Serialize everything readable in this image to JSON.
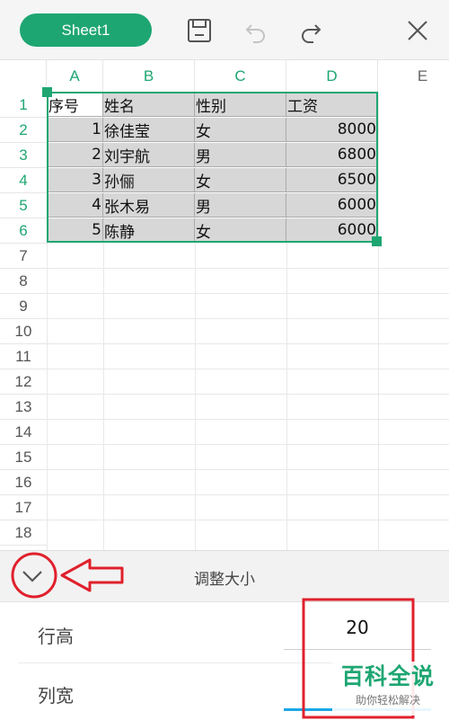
{
  "toolbar": {
    "sheet_tab": "Sheet1",
    "icons": [
      "save-icon",
      "undo-icon",
      "redo-icon",
      "close-icon"
    ]
  },
  "sheet": {
    "columns": [
      "A",
      "B",
      "C",
      "D",
      "E"
    ],
    "rows": [
      "1",
      "2",
      "3",
      "4",
      "5",
      "6",
      "7",
      "8",
      "9",
      "10",
      "11",
      "12",
      "13",
      "14",
      "15",
      "16",
      "17",
      "18"
    ],
    "header_row": [
      "序号",
      "姓名",
      "性别",
      "工资"
    ],
    "data": [
      [
        "1",
        "徐佳莹",
        "女",
        "8000"
      ],
      [
        "2",
        "刘宇航",
        "男",
        "6800"
      ],
      [
        "3",
        "孙俪",
        "女",
        "6500"
      ],
      [
        "4",
        "张木易",
        "男",
        "6000"
      ],
      [
        "5",
        "陈静",
        "女",
        "6000"
      ]
    ]
  },
  "panel": {
    "title": "调整大小",
    "row_height_label": "行高",
    "row_height_value": "20",
    "col_width_label": "列宽"
  },
  "watermark": {
    "title": "百科全说",
    "subtitle": "助你轻松解决"
  },
  "colors": {
    "accent": "#1ea672",
    "annotation": "#e0202c"
  }
}
